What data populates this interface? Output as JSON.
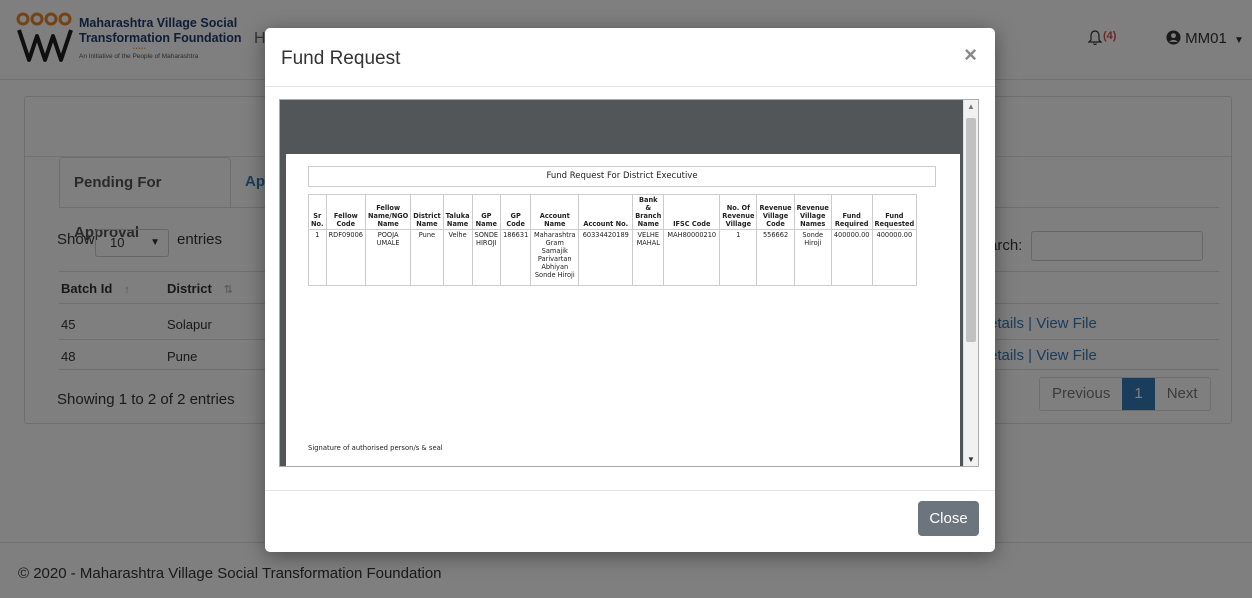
{
  "navbar": {
    "logo_line1": "Maharashtra Village Social",
    "logo_line2": "Transformation Foundation",
    "logo_dots": "•••••",
    "logo_tagline": "An Initiative of the People of Maharashtra",
    "nav_partial": "H",
    "notification_count": "(4)",
    "user_name": "MM01"
  },
  "page": {
    "tabs": [
      {
        "label": "Pending For Approval"
      },
      {
        "label": "App"
      }
    ],
    "show_label": "Show",
    "entries_value": "10",
    "entries_label": "entries",
    "search_label": "arch:",
    "columns": [
      {
        "label": "Batch Id"
      },
      {
        "label": "District"
      }
    ],
    "rows": [
      {
        "batch_id": "45",
        "district": "Solapur",
        "links": "etails | View File"
      },
      {
        "batch_id": "48",
        "district": "Pune",
        "links": "etails | View File"
      }
    ],
    "showing_text": "Showing 1 to 2 of 2 entries",
    "pager": {
      "previous": "Previous",
      "current": "1",
      "next": "Next"
    }
  },
  "footer": {
    "text": "© 2020 - Maharashtra Village Social Transformation Foundation"
  },
  "modal": {
    "title": "Fund Request",
    "close_x": "×",
    "close_button": "Close",
    "document": {
      "title": "Fund Request For District Executive",
      "headers": [
        "Sr No.",
        "Fellow Code",
        "Fellow Name/NGO Name",
        "District Name",
        "Taluka Name",
        "GP Name",
        "GP Code",
        "Account Name",
        "Account No.",
        "Bank & Branch Name",
        "IFSC Code",
        "No. Of Revenue Village",
        "Revenue Village Code",
        "Revenue Village Names",
        "Fund Required",
        "Fund Requested"
      ],
      "row": [
        "1",
        "RDF09006",
        "POOJA UMALE",
        "Pune",
        "Velhe",
        "SONDE HIROJI",
        "186631",
        "Maharashtra Gram Samajik Parivartan Abhiyan Sonde Hiroji",
        "60334420189",
        "VELHE MAHAL",
        "MAH80000210",
        "1",
        "556662",
        "Sonde Hiroji",
        "400000.00",
        "400000.00"
      ],
      "signature": "Signature of authorised person/s & seal"
    }
  },
  "colors": {
    "brand_blue": "#337ab7",
    "notification_red": "#d9534f",
    "close_button": "#6c757d",
    "pdf_viewer_bg": "#525659"
  },
  "icons": {
    "bell": "bell-icon",
    "user": "user-circle-icon",
    "dropdown": "caret-down-icon",
    "sort": "sort-icon",
    "close": "close-icon"
  }
}
